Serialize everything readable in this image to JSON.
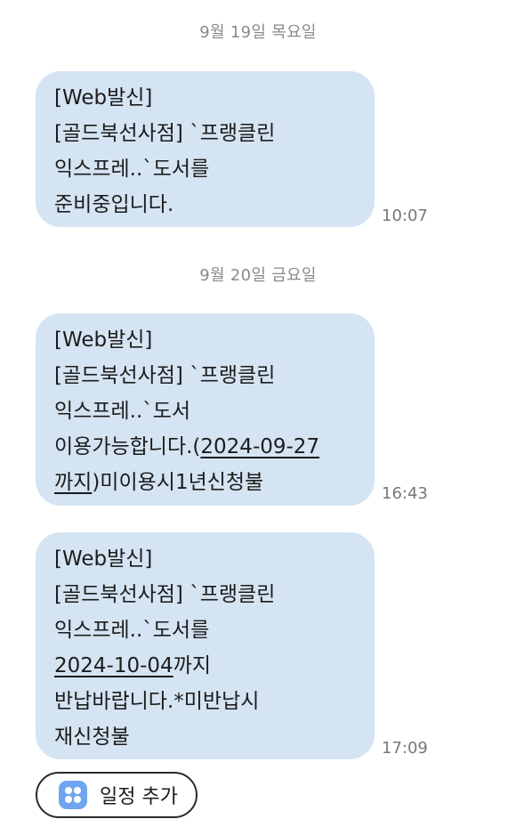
{
  "conversation": {
    "groups": [
      {
        "date": "9월 19일 목요일",
        "messages": [
          {
            "time": "10:07",
            "lines": [
              [
                {
                  "t": "[Web발신]"
                }
              ],
              [
                {
                  "t": "[골드북선사점] `프랭클린"
                }
              ],
              [
                {
                  "t": "익스프레..`도서를"
                }
              ],
              [
                {
                  "t": "준비중입니다."
                }
              ]
            ]
          }
        ]
      },
      {
        "date": "9월 20일 금요일",
        "messages": [
          {
            "time": "16:43",
            "lines": [
              [
                {
                  "t": "[Web발신]"
                }
              ],
              [
                {
                  "t": "[골드북선사점] `프랭클린"
                }
              ],
              [
                {
                  "t": "익스프레..`도서"
                }
              ],
              [
                {
                  "t": "이용가능합니다.("
                },
                {
                  "t": "2024-09-27",
                  "link": true
                }
              ],
              [
                {
                  "t": "까지",
                  "link": true
                },
                {
                  "t": ")미이용시1년신청불"
                }
              ]
            ]
          },
          {
            "time": "17:09",
            "lines": [
              [
                {
                  "t": "[Web발신]"
                }
              ],
              [
                {
                  "t": "[골드북선사점] `프랭클린"
                }
              ],
              [
                {
                  "t": "익스프레..`도서를"
                }
              ],
              [
                {
                  "t": "2024-10-04",
                  "link": true
                },
                {
                  "t": "까지"
                }
              ],
              [
                {
                  "t": "반납바랍니다.*미반납시"
                }
              ],
              [
                {
                  "t": "재신청불"
                }
              ]
            ]
          }
        ]
      }
    ]
  },
  "actions": {
    "add_schedule_label": "일정 추가",
    "add_schedule_icon": "calendar-dots-icon"
  },
  "colors": {
    "bubble": "#d5e4f2",
    "date_text": "#8a8a8a",
    "time_text": "#777777",
    "icon_accent": "#6ea5ee"
  }
}
